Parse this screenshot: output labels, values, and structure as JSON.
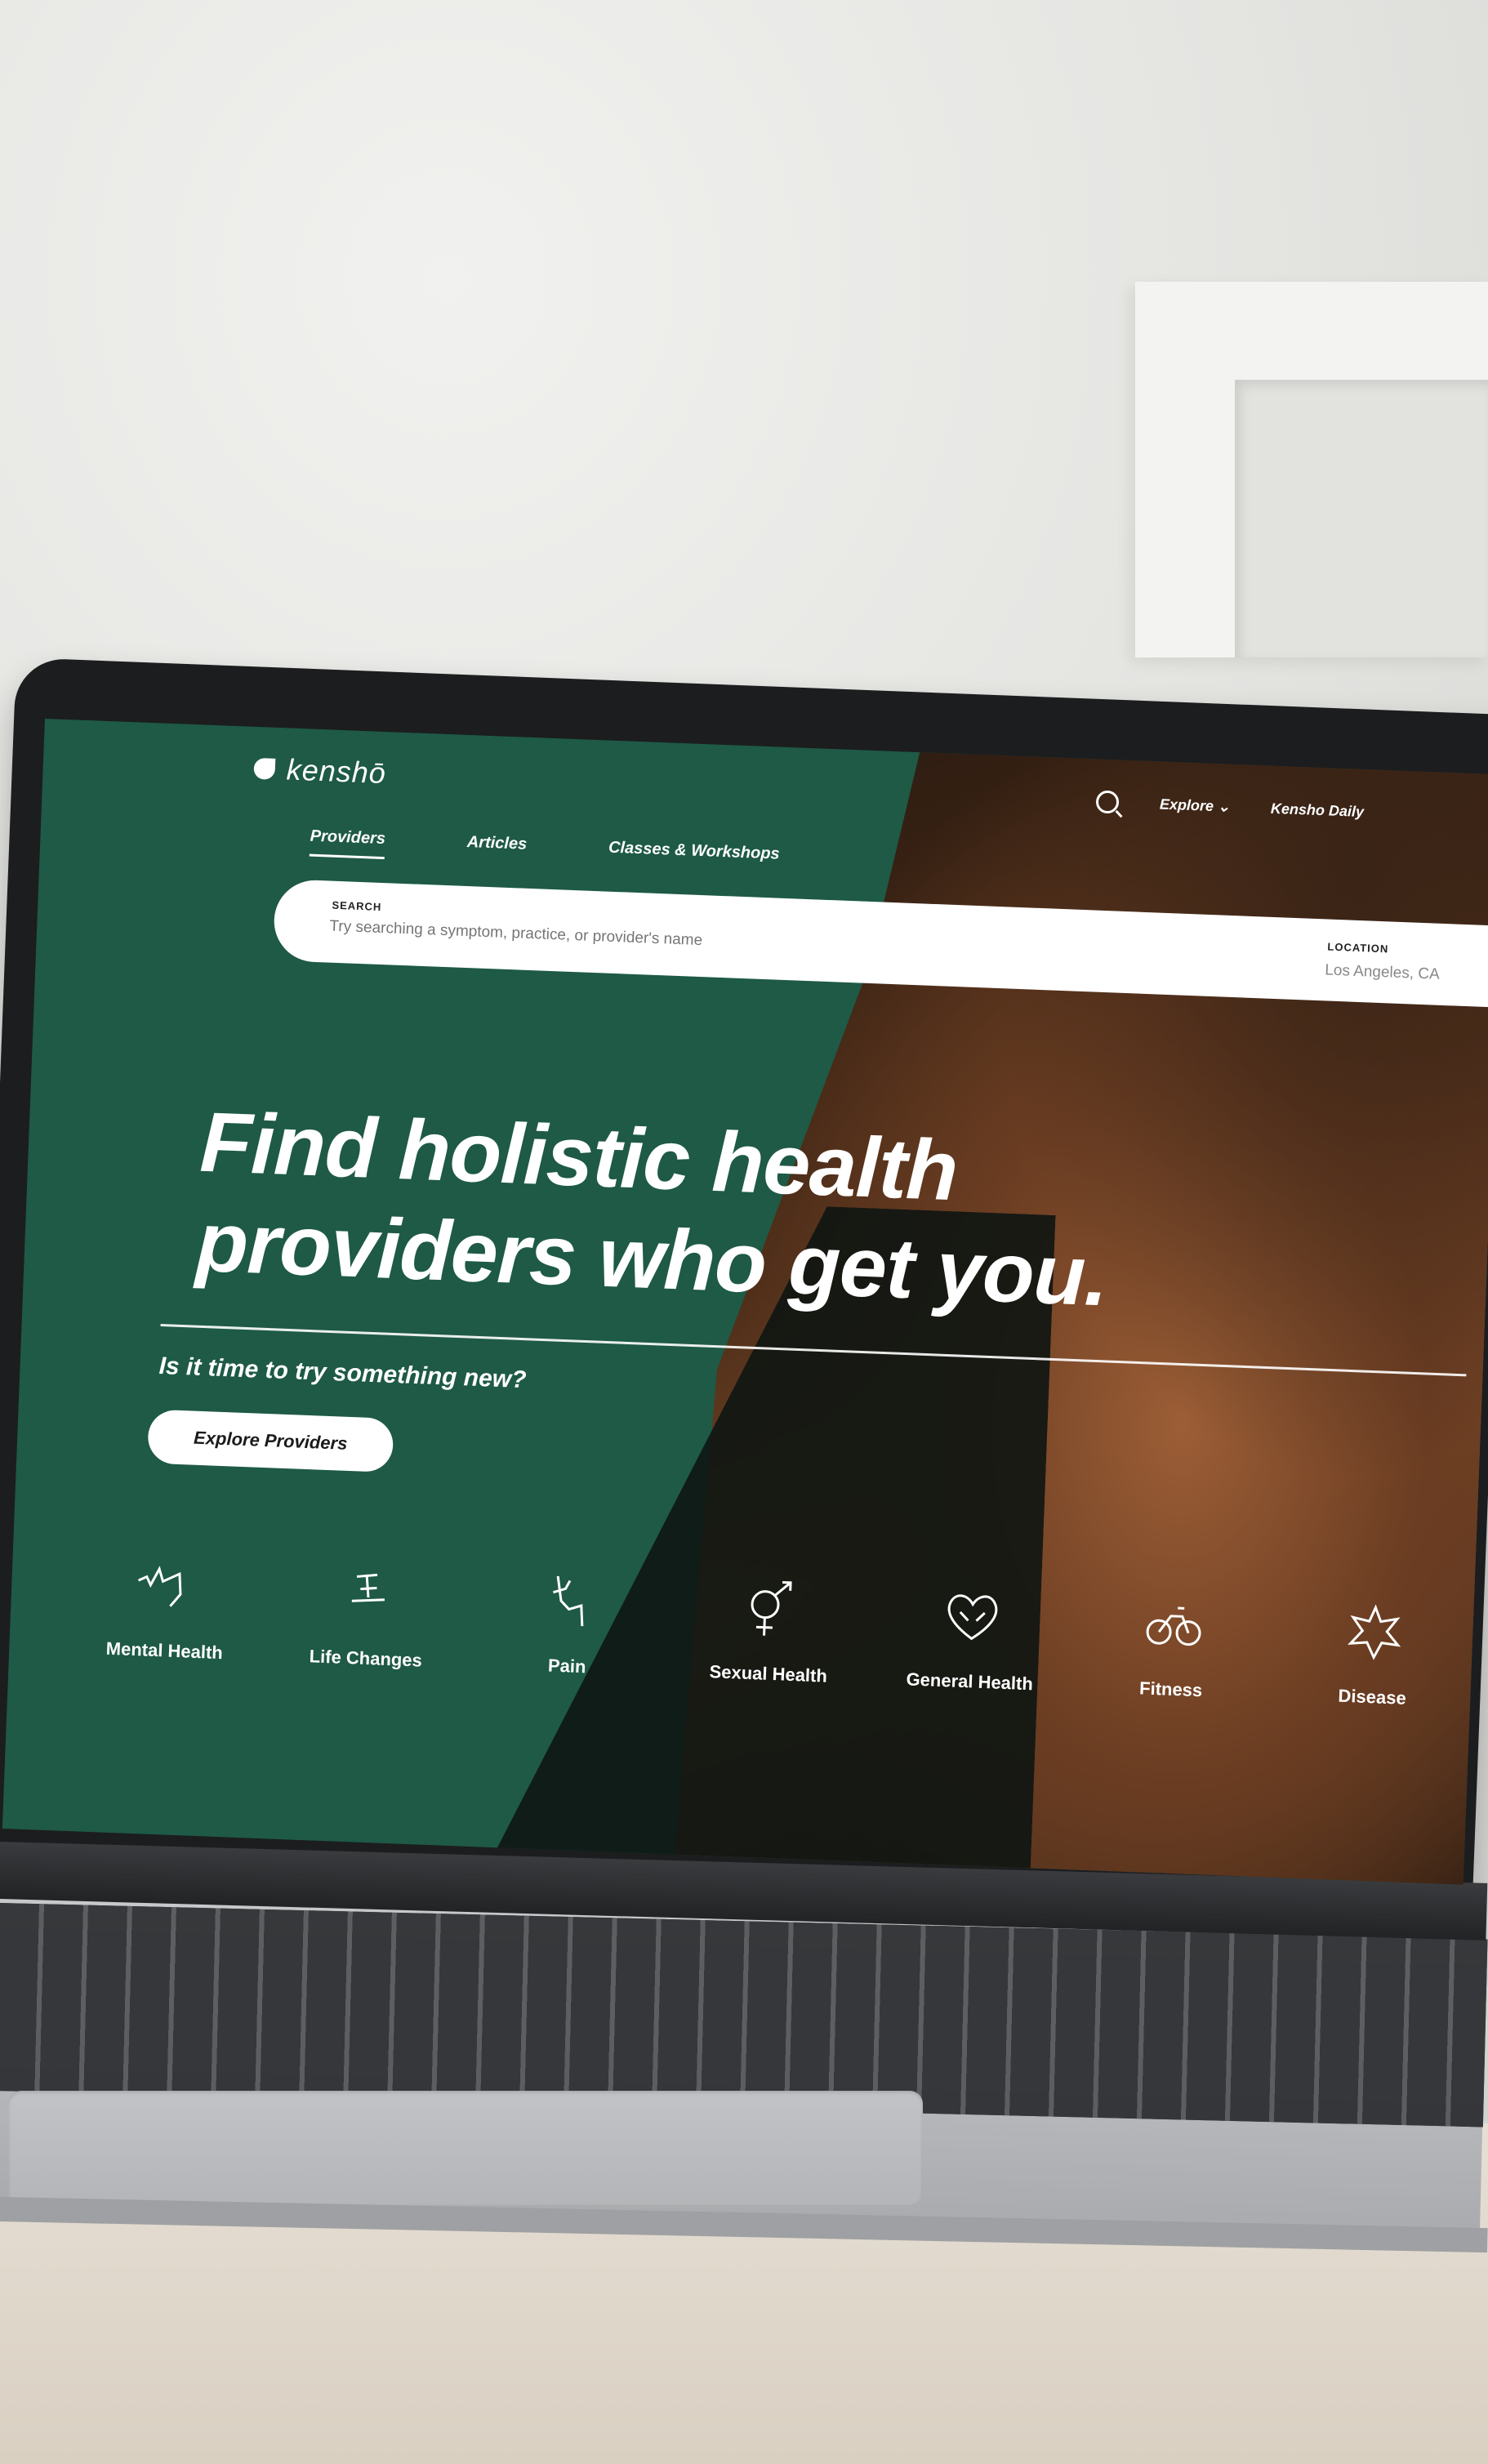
{
  "brand": {
    "name": "kenshō"
  },
  "topnav": {
    "explore": "Explore ⌄",
    "daily": "Kensho Daily"
  },
  "tabs": [
    {
      "label": "Providers",
      "active": true
    },
    {
      "label": "Articles",
      "active": false
    },
    {
      "label": "Classes & Workshops",
      "active": false
    }
  ],
  "search": {
    "label": "SEARCH",
    "placeholder": "Try searching a symptom, practice, or provider's name",
    "location_label": "LOCATION",
    "location_value": "Los Angeles, CA"
  },
  "hero": {
    "line1": "Find holistic health",
    "line2": "providers who get you.",
    "subline": "Is it time to try something new?",
    "cta": "Explore Providers"
  },
  "categories": [
    {
      "label": "Mental Health",
      "icon": "mental-health-icon"
    },
    {
      "label": "Life Changes",
      "icon": "life-changes-icon"
    },
    {
      "label": "Pain",
      "icon": "pain-icon"
    },
    {
      "label": "Sexual Health",
      "icon": "sexual-health-icon"
    },
    {
      "label": "General Health",
      "icon": "general-health-icon"
    },
    {
      "label": "Fitness",
      "icon": "fitness-icon"
    },
    {
      "label": "Disease",
      "icon": "disease-icon"
    }
  ],
  "colors": {
    "brand_green": "#1e5a45",
    "white": "#ffffff"
  }
}
